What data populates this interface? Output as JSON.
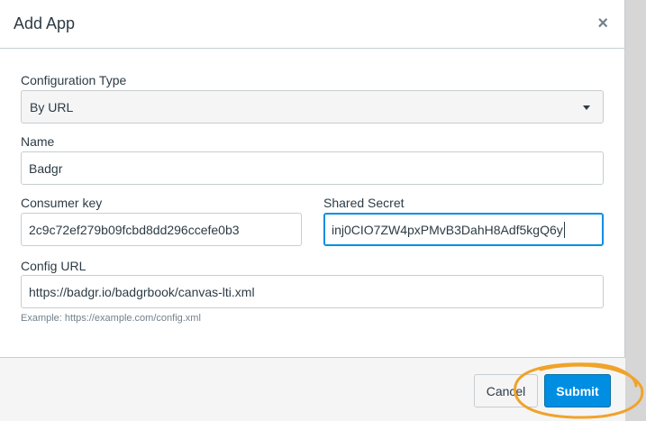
{
  "dialog": {
    "title": "Add App",
    "close_glyph": "×"
  },
  "form": {
    "configuration_type": {
      "label": "Configuration Type",
      "value": "By URL"
    },
    "name": {
      "label": "Name",
      "value": "Badgr"
    },
    "consumer_key": {
      "label": "Consumer key",
      "value": "2c9c72ef279b09fcbd8dd296ccefe0b3"
    },
    "shared_secret": {
      "label": "Shared Secret",
      "value": "inj0CIO7ZW4pxPMvB3DahH8Adf5kgQ6y"
    },
    "config_url": {
      "label": "Config URL",
      "value": "https://badgr.io/badgrbook/canvas-lti.xml",
      "help": "Example: https://example.com/config.xml"
    }
  },
  "footer": {
    "cancel_label": "Cancel",
    "submit_label": "Submit"
  },
  "colors": {
    "accent": "#008ee2",
    "annotation_circle": "#f0a32a"
  },
  "icons": {
    "close": "close-icon",
    "dropdown": "chevron-down-icon"
  }
}
